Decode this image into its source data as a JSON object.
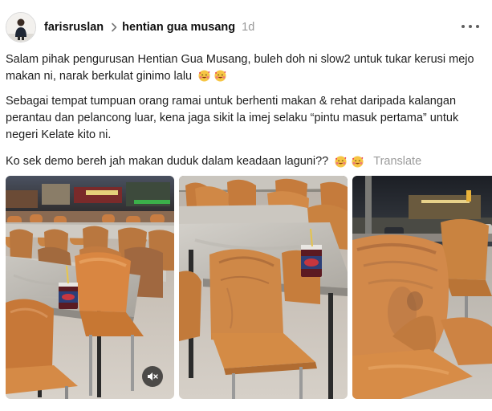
{
  "post": {
    "author": {
      "username": "farisruslan",
      "avatar_icon": "user-avatar"
    },
    "community": "hentian gua musang",
    "age": "1d",
    "more_icon": "more-horizontal-icon",
    "paragraphs": {
      "p1": "Salam pihak pengurusan Hentian Gua Musang, buleh doh ni slow2 untuk tukar kerusi mejo makan ni, narak berkulat ginimo lalu",
      "p2": "Sebagai tempat tumpuan orang ramai untuk berhenti makan & rehat daripada kalangan perantau dan pelancong luar, kena jaga sikit la imej selaku “pintu masuk pertama” untuk negeri Kelate kito ni.",
      "p3": "Ko sek demo bereh jah makan duduk dalam keadaan laguni??"
    },
    "emoji_name": "smiling-face-with-hearts",
    "translate_label": "Translate",
    "media": [
      {
        "kind": "video",
        "subject": "food court tables and orange chairs with drink cup",
        "mute_icon": "speaker-muted-icon"
      },
      {
        "kind": "image",
        "subject": "marble table with drink cup and dirty orange chairs"
      },
      {
        "kind": "image",
        "subject": "close-up of mouldy orange plastic chair"
      }
    ],
    "colors": {
      "chair_orange": "#d9853f",
      "text": "#1e1e1e",
      "muted": "#999999"
    }
  }
}
